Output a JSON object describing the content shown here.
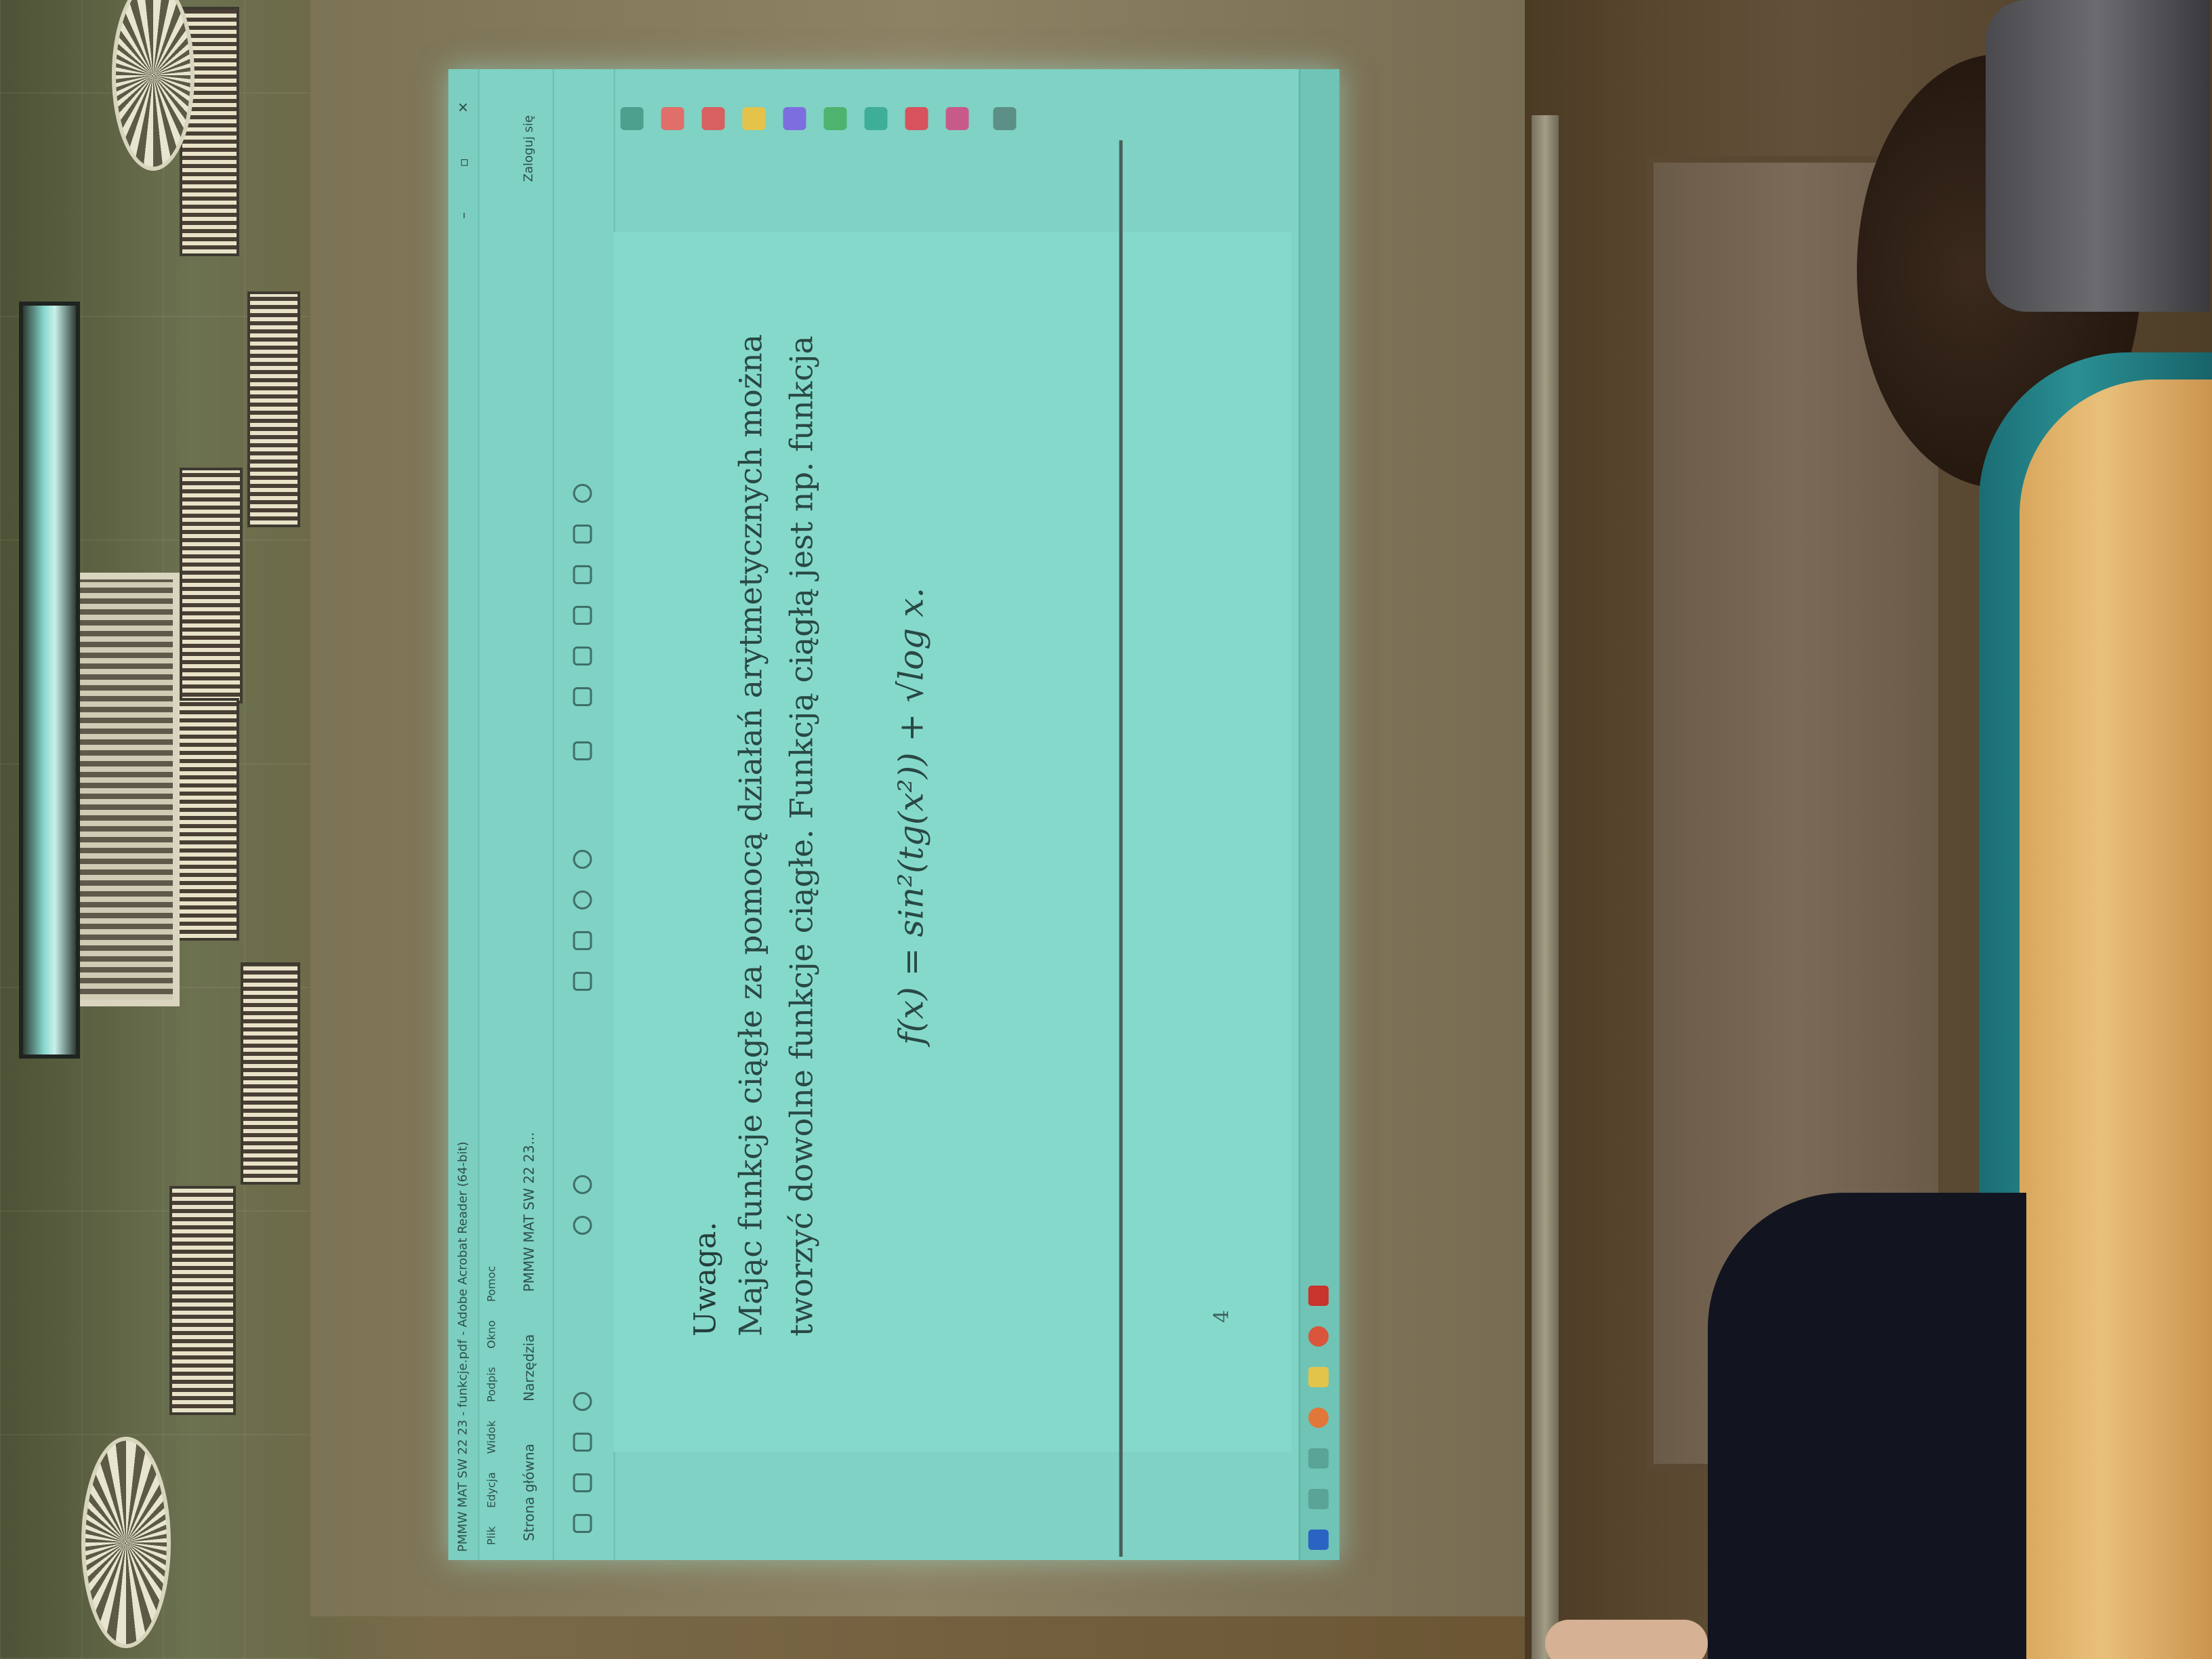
{
  "window": {
    "title": "PMMW MAT SW 22 23 - funkcje.pdf - Adobe Acrobat Reader (64-bit)",
    "controls": "– ▫ ✕"
  },
  "menubar": [
    "Plik",
    "Edycja",
    "Widok",
    "Podpis",
    "Okno",
    "Pomoc"
  ],
  "tabs": {
    "home": "Strona główna",
    "tools": "Narzędzia",
    "document": "PMMW MAT SW 22 23...",
    "signin": "Zaloguj się"
  },
  "document": {
    "heading": "Uwaga.",
    "line1": "Mając funkcje ciągłe za pomocą działań arytmetycznych można",
    "line2": "tworzyć dowolne funkcje ciągłe. Funkcją ciągłą jest np. funkcja",
    "formula": "f(x) = sin²(tg(x²)) + √log x.",
    "page_number": "4"
  },
  "colors": {
    "projection": "#7fd2c4",
    "text": "#294843",
    "chair_teal": "#2a8f93",
    "chair_wood": "#e9c07a"
  }
}
